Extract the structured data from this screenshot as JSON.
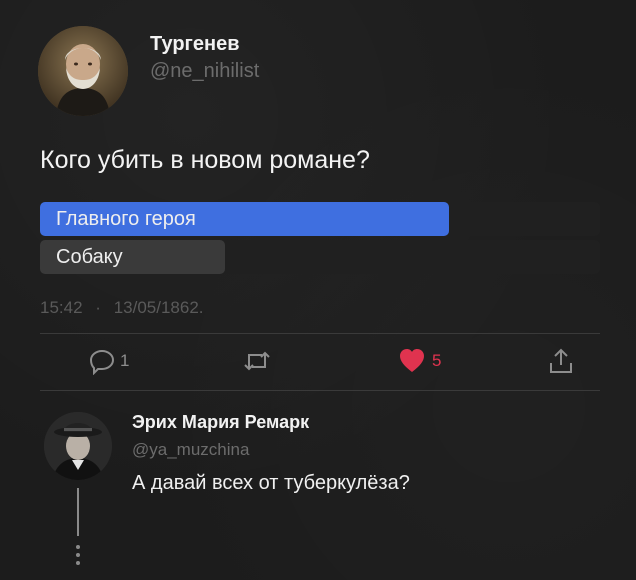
{
  "tweet": {
    "author_name": "Тургенев",
    "author_handle": "@ne_nihilist",
    "avatar_icon": "portrait-bearded-man-icon",
    "question": "Кого убить в новом романе?",
    "poll": [
      {
        "label": "Главного героя",
        "fraction": 0.73,
        "color": "#3f6fe0"
      },
      {
        "label": "Собаку",
        "fraction": 0.33,
        "color": "#3a3a3a"
      }
    ],
    "time": "15:42",
    "separator": "·",
    "date": "13/05/1862.",
    "actions": {
      "reply_count": "1",
      "retweet_count": "",
      "like_count": "5",
      "like_color": "#e0334f",
      "icons": [
        "reply-icon",
        "retweet-icon",
        "heart-icon",
        "share-icon"
      ]
    }
  },
  "reply": {
    "author_name": "Эрих Мария Ремарк",
    "author_handle": "@ya_muzchina",
    "avatar_icon": "portrait-man-in-hat-icon",
    "text": "А давай всех от туберкулёза?"
  },
  "colors": {
    "background": "#1c1c1c",
    "accent": "#3f6fe0",
    "muted_text": "#6c6c6c"
  }
}
